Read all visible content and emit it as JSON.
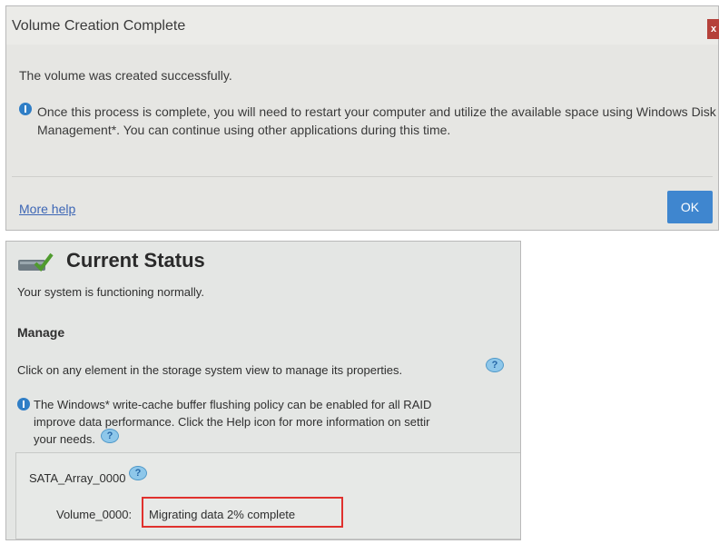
{
  "dialog": {
    "title": "Volume Creation Complete",
    "close_label": "x",
    "message": "The volume was created successfully.",
    "info": "Once this process is complete, you will need to restart your computer and utilize the available space using Windows Disk Management*. You can continue using other applications during this time.",
    "help_link": "More help",
    "ok_label": "OK"
  },
  "status": {
    "title": "Current Status",
    "system_text": "Your system is functioning normally.",
    "manage_title": "Manage",
    "click_text": "Click on any element in the storage system view to manage its properties.",
    "cache_line1": "The Windows* write-cache buffer flushing policy can be enabled for all RAID",
    "cache_line2": "improve data performance. Click the Help icon for more information on settir",
    "cache_line3": "your needs.",
    "array_name": "SATA_Array_0000",
    "volume_label": "Volume_0000:",
    "volume_status": "Migrating data 2% complete",
    "help_symbol": "?"
  },
  "colors": {
    "accent_blue": "#3f86cf",
    "highlight_red": "#e0312e",
    "close_red": "#b5413a"
  }
}
